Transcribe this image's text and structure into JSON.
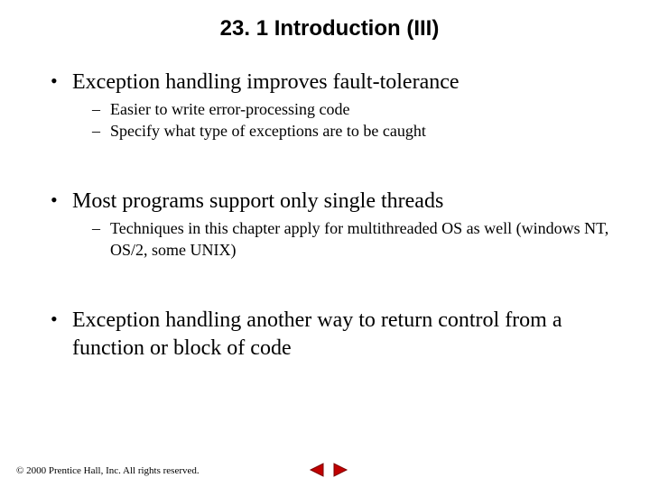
{
  "title": "23. 1   Introduction (III)",
  "bullets": [
    {
      "text": "Exception handling improves fault-tolerance",
      "sub": [
        "Easier to write error-processing code",
        "Specify what type of exceptions are to be caught"
      ]
    },
    {
      "text": "Most programs support only single threads",
      "sub": [
        "Techniques in this chapter apply for multithreaded OS as well (windows NT, OS/2, some UNIX)"
      ]
    },
    {
      "text": "Exception handling another way to return control from a function or block of code",
      "sub": []
    }
  ],
  "footer": "© 2000 Prentice Hall, Inc. All rights reserved.",
  "nav": {
    "prev": "previous-slide",
    "next": "next-slide"
  },
  "colors": {
    "nav_fill": "#c00000",
    "nav_border": "#7a0000"
  }
}
